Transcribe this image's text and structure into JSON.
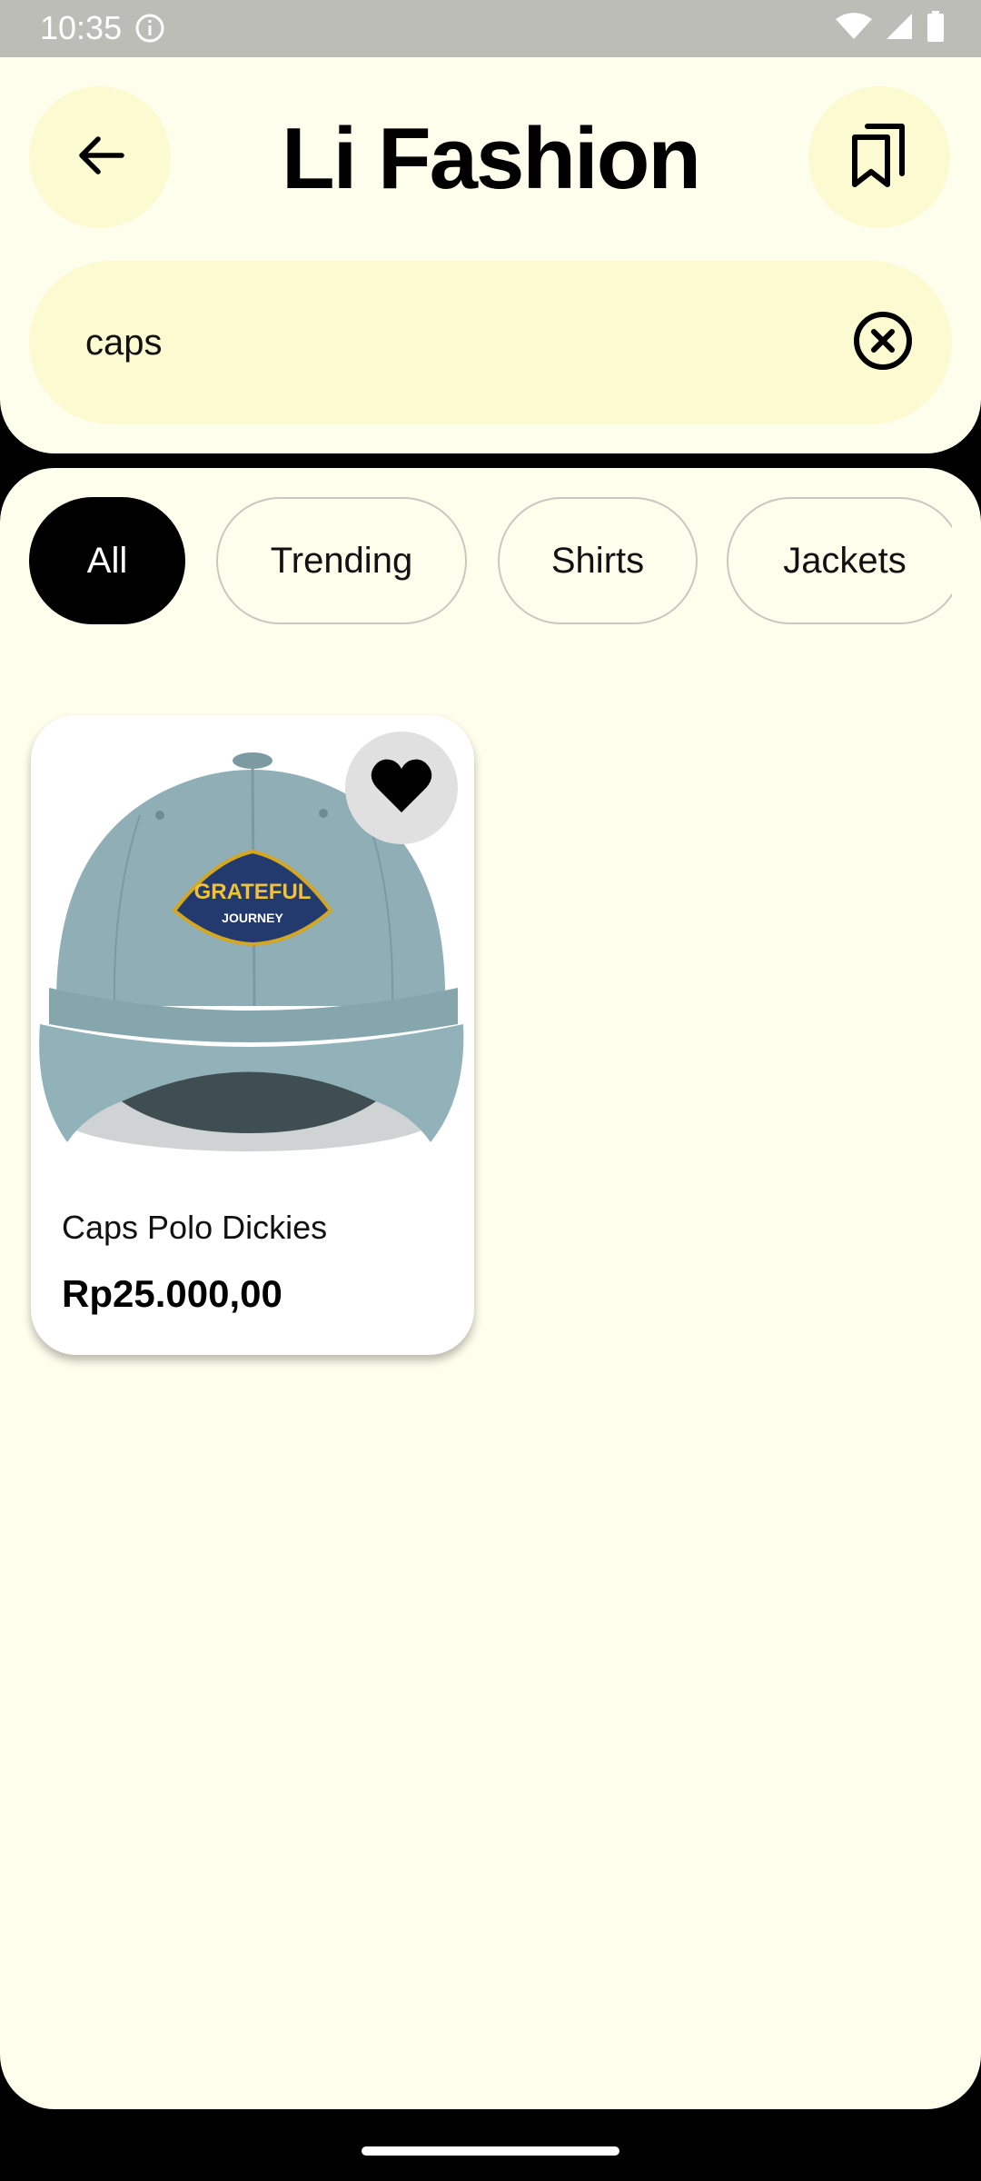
{
  "status_bar": {
    "time": "10:35",
    "icons": [
      "info-icon",
      "wifi-icon",
      "signal-icon",
      "battery-icon"
    ]
  },
  "header": {
    "title": "Li Fashion",
    "back_icon": "arrow-left-icon",
    "saved_icon": "bookmarks-icon"
  },
  "search": {
    "value": "caps",
    "clear_icon": "close-circle-icon"
  },
  "filters": {
    "chips": [
      {
        "label": "All",
        "active": true
      },
      {
        "label": "Trending",
        "active": false
      },
      {
        "label": "Shirts",
        "active": false
      },
      {
        "label": "Jackets",
        "active": false
      }
    ]
  },
  "products": [
    {
      "name": "Caps Polo Dickies",
      "price": "Rp25.000,00",
      "favorite": true,
      "image_logo_text_top": "GRATEFUL",
      "image_logo_text_bottom": "JOURNEY"
    }
  ],
  "colors": {
    "background": "#fefeed",
    "accent_soft": "#fcfad0",
    "active_chip": "#000000",
    "status_bar": "#bdbdb7"
  }
}
